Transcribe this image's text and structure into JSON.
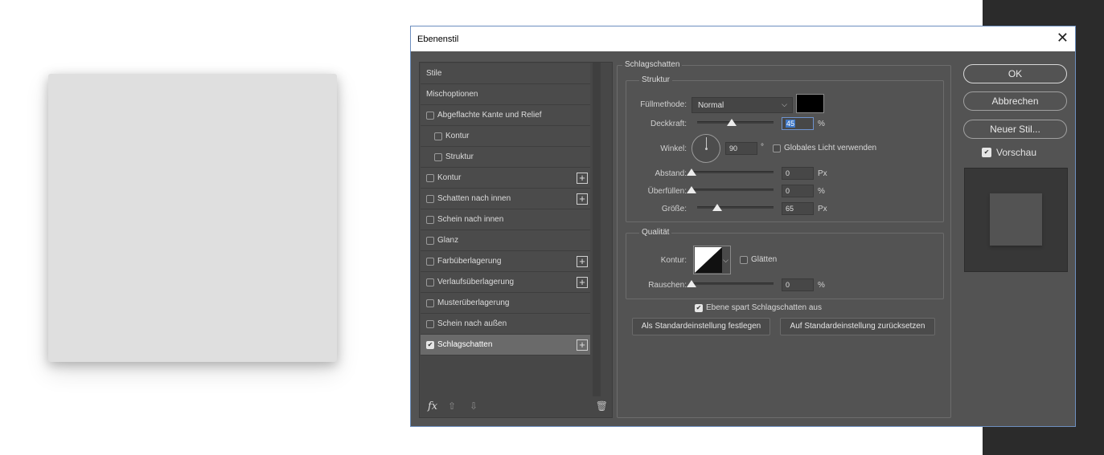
{
  "dialog": {
    "title": "Ebenenstil",
    "close_glyph": "✕"
  },
  "styles": {
    "items": [
      {
        "label": "Stile",
        "checkbox": false,
        "checked": false,
        "plus": false,
        "indent": false,
        "selected": false
      },
      {
        "label": "Mischoptionen",
        "checkbox": false,
        "checked": false,
        "plus": false,
        "indent": false,
        "selected": false
      },
      {
        "label": "Abgeflachte Kante und Relief",
        "checkbox": true,
        "checked": false,
        "plus": false,
        "indent": false,
        "selected": false
      },
      {
        "label": "Kontur",
        "checkbox": true,
        "checked": false,
        "plus": false,
        "indent": true,
        "selected": false
      },
      {
        "label": "Struktur",
        "checkbox": true,
        "checked": false,
        "plus": false,
        "indent": true,
        "selected": false
      },
      {
        "label": "Kontur",
        "checkbox": true,
        "checked": false,
        "plus": true,
        "indent": false,
        "selected": false
      },
      {
        "label": "Schatten nach innen",
        "checkbox": true,
        "checked": false,
        "plus": true,
        "indent": false,
        "selected": false
      },
      {
        "label": "Schein nach innen",
        "checkbox": true,
        "checked": false,
        "plus": false,
        "indent": false,
        "selected": false
      },
      {
        "label": "Glanz",
        "checkbox": true,
        "checked": false,
        "plus": false,
        "indent": false,
        "selected": false
      },
      {
        "label": "Farbüberlagerung",
        "checkbox": true,
        "checked": false,
        "plus": true,
        "indent": false,
        "selected": false
      },
      {
        "label": "Verlaufsüberlagerung",
        "checkbox": true,
        "checked": false,
        "plus": true,
        "indent": false,
        "selected": false
      },
      {
        "label": "Musterüberlagerung",
        "checkbox": true,
        "checked": false,
        "plus": false,
        "indent": false,
        "selected": false
      },
      {
        "label": "Schein nach außen",
        "checkbox": true,
        "checked": false,
        "plus": false,
        "indent": false,
        "selected": false
      },
      {
        "label": "Schlagschatten",
        "checkbox": true,
        "checked": true,
        "plus": true,
        "indent": false,
        "selected": true
      }
    ],
    "footer": {
      "fx": "fx",
      "up": "⇧",
      "down": "⇩",
      "trash": "🗑"
    }
  },
  "drop_shadow": {
    "section_title": "Schlagschatten",
    "structure": {
      "title": "Struktur",
      "blend_mode_label": "Füllmethode:",
      "blend_mode_value": "Normal",
      "shadow_color": "#000000",
      "opacity_label": "Deckkraft:",
      "opacity_value": "45",
      "opacity_unit": "%",
      "opacity_fraction": 0.45,
      "angle_label": "Winkel:",
      "angle_value": "90",
      "angle_unit": "°",
      "global_light_label": "Globales Licht verwenden",
      "distance_label": "Abstand:",
      "distance_value": "0",
      "distance_unit": "Px",
      "distance_fraction": 0,
      "spread_label": "Überfüllen:",
      "spread_value": "0",
      "spread_unit": "%",
      "spread_fraction": 0,
      "size_label": "Größe:",
      "size_value": "65",
      "size_unit": "Px",
      "size_fraction": 0.26
    },
    "quality": {
      "title": "Qualität",
      "contour_label": "Kontur:",
      "antialias_label": "Glätten",
      "noise_label": "Rauschen:",
      "noise_value": "0",
      "noise_unit": "%",
      "noise_fraction": 0
    },
    "knockout_label": "Ebene spart Schlagschatten aus",
    "make_default_label": "Als Standardeinstellung festlegen",
    "reset_default_label": "Auf Standardeinstellung zurücksetzen"
  },
  "buttons": {
    "ok": "OK",
    "cancel": "Abbrechen",
    "new_style": "Neuer Stil..."
  },
  "preview": {
    "label": "Vorschau",
    "checked": true
  }
}
